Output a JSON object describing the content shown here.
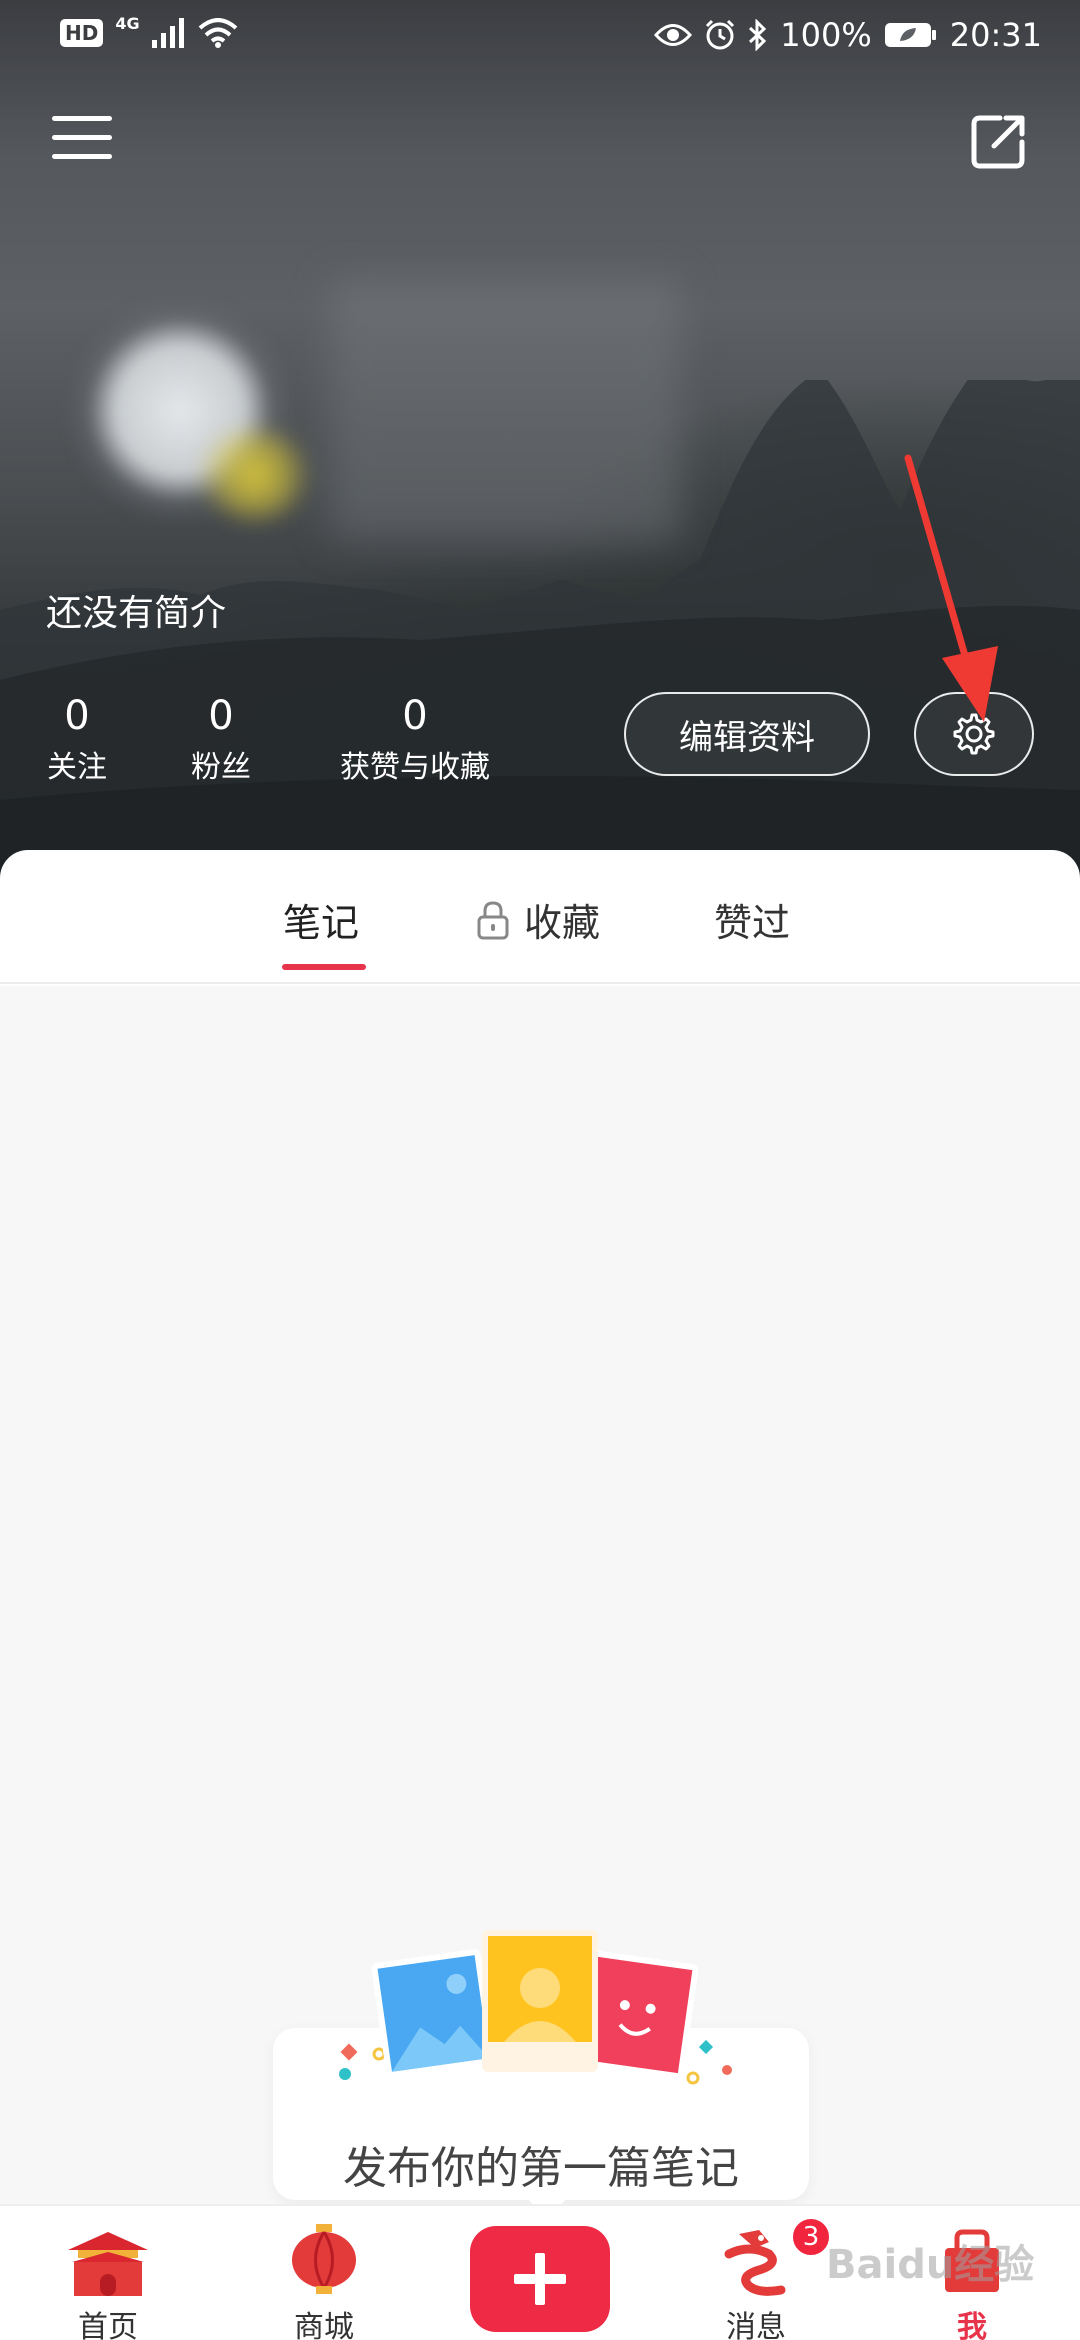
{
  "statusbar": {
    "hd": "HD",
    "network": "4G",
    "battery": "100%",
    "time": "20:31"
  },
  "profile": {
    "bio": "还没有简介",
    "stats": [
      {
        "value": "0",
        "label": "关注"
      },
      {
        "value": "0",
        "label": "粉丝"
      },
      {
        "value": "0",
        "label": "获赞与收藏"
      }
    ],
    "edit_label": "编辑资料"
  },
  "tabs": [
    {
      "label": "笔记",
      "active": true
    },
    {
      "label": "收藏",
      "locked": true
    },
    {
      "label": "赞过"
    }
  ],
  "empty_state": {
    "text": "发布你的第一篇笔记"
  },
  "bottom_nav": {
    "items": [
      {
        "label": "首页",
        "icon": "palace-icon"
      },
      {
        "label": "商城",
        "icon": "lantern-icon"
      },
      {
        "label": "消息",
        "icon": "lion-dance-icon"
      },
      {
        "label": "我",
        "icon": "me-icon",
        "active": true
      }
    ],
    "messages_badge": "3",
    "post_icon": "plus-icon"
  },
  "watermark": "Baidu经验",
  "colors": {
    "accent": "#e8344a",
    "post_button": "#ee2a44",
    "annotation_arrow": "#ee3a33"
  }
}
